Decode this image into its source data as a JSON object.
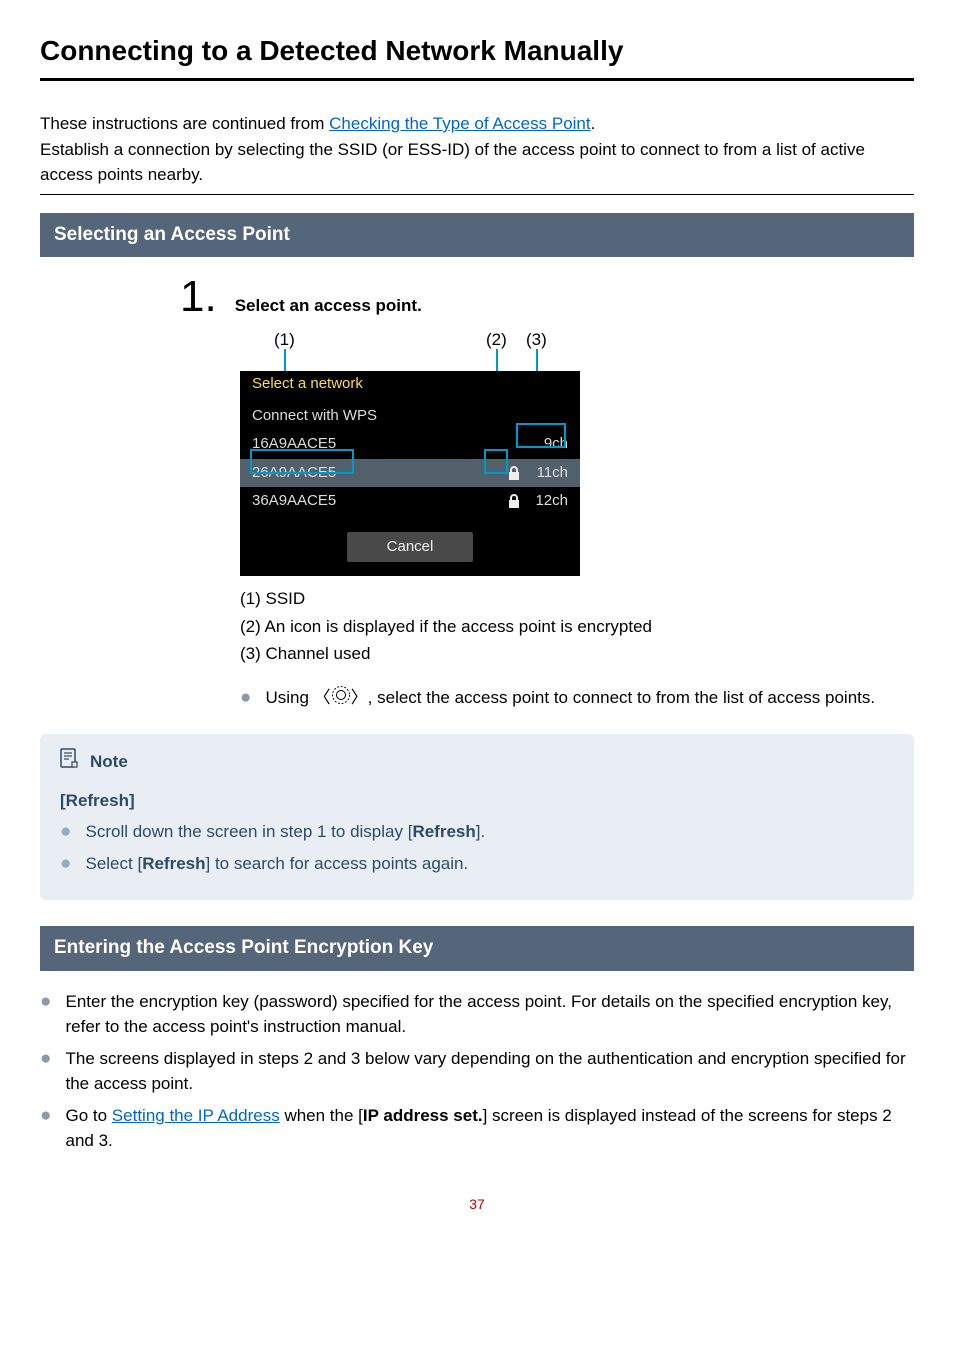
{
  "title": "Connecting to a Detected Network Manually",
  "intro": {
    "l1a": "These instructions are continued from ",
    "l1_link": "Checking the Type of Access Point",
    "l1b": ".",
    "l2": "Establish a connection by selecting the SSID (or ESS-ID) of the access point to connect to from a list of active access points nearby."
  },
  "sections": {
    "selecting_title": "Selecting an Access Point",
    "entering_title": "Entering the Access Point Encryption Key"
  },
  "step1": {
    "number": "1.",
    "label": "Select an access point."
  },
  "callouts": {
    "c1": "(1)",
    "c2": "(2)",
    "c3": "(3)"
  },
  "camera": {
    "header": "Select a network",
    "rows": [
      {
        "ssid": "Connect with WPS",
        "lock": false,
        "ch": ""
      },
      {
        "ssid": "16A9AACE5",
        "lock": false,
        "ch": "9ch"
      },
      {
        "ssid": "26A9AACE5",
        "lock": true,
        "ch": "11ch"
      },
      {
        "ssid": "36A9AACE5",
        "lock": true,
        "ch": "12ch"
      }
    ],
    "cancel": "Cancel"
  },
  "legend": {
    "l1": "(1) SSID",
    "l2": "(2) An icon is displayed if the access point is encrypted",
    "l3": "(3) Channel used"
  },
  "dial_bullet": {
    "pre": "Using 〈",
    "post": "〉, select the access point to connect to from the list of access points."
  },
  "note": {
    "title": "Note",
    "sub": "[Refresh]",
    "b1a": "Scroll down the screen in step 1 to display [",
    "b1_bold": "Refresh",
    "b1b": "].",
    "b2a": "Select [",
    "b2_bold": "Refresh",
    "b2b": "] to search for access points again."
  },
  "entering": {
    "b1": "Enter the encryption key (password) specified for the access point. For details on the specified encryption key, refer to the access point's instruction manual.",
    "b2": "The screens displayed in steps 2 and 3 below vary depending on the authentication and encryption specified for the access point.",
    "b3a": "Go to ",
    "b3_link": "Setting the IP Address",
    "b3b": " when the [",
    "b3_bold": "IP address set.",
    "b3c": "] screen is displayed instead of the screens for steps 2 and 3."
  },
  "page_number": "37"
}
